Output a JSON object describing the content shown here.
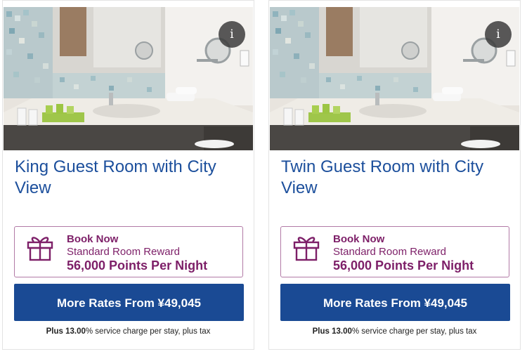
{
  "cards": [
    {
      "info_label": "i",
      "title": "King Guest Room with City View",
      "reward": {
        "line1": "Book Now",
        "line2": "Standard Room Reward",
        "line3": "56,000 Points Per Night"
      },
      "rates_button": "More Rates From ¥49,045",
      "charge": {
        "prefix": "Plus 13.00",
        "suffix": "% service charge per stay, plus tax"
      }
    },
    {
      "info_label": "i",
      "title": "Twin Guest Room with City View",
      "reward": {
        "line1": "Book Now",
        "line2": "Standard Room Reward",
        "line3": "56,000 Points Per Night"
      },
      "rates_button": "More Rates From ¥49,045",
      "charge": {
        "prefix": "Plus 13.00",
        "suffix": "% service charge per stay, plus tax"
      }
    }
  ],
  "colors": {
    "title_blue": "#1c4f9c",
    "reward_purple": "#7d1f68",
    "button_blue": "#1a4a94"
  },
  "icons": {
    "info": "info-icon",
    "gift": "gift-icon"
  }
}
